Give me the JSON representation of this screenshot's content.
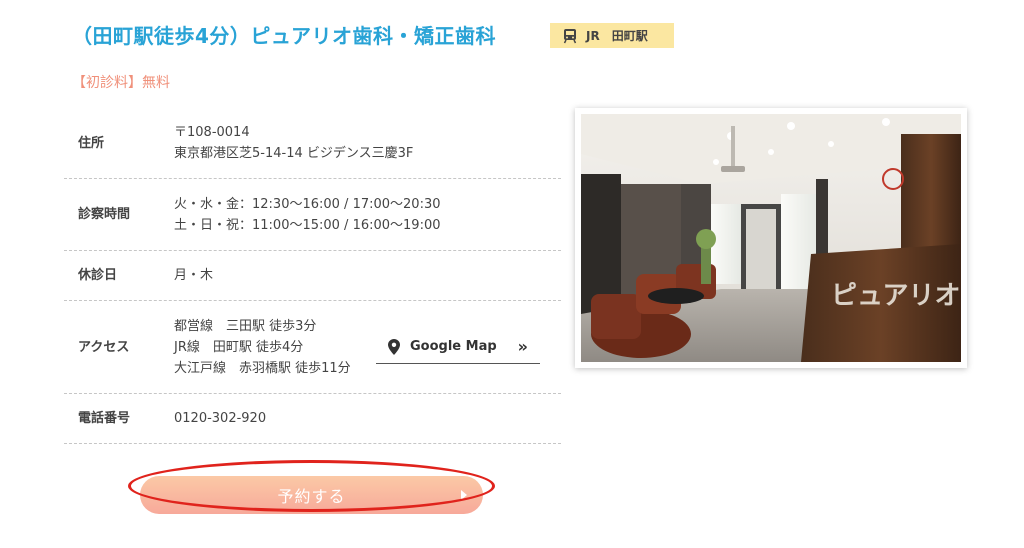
{
  "header": {
    "title": "（田町駅徒歩4分）ピュアリオ歯科・矯正歯科",
    "station_line": "JR",
    "station_name": "田町駅"
  },
  "fee": {
    "label": "【初診料】",
    "value": "無料"
  },
  "info": {
    "address": {
      "label": "住所",
      "postal": "〒108-0014",
      "street": "東京都港区芝5-14-14 ビジデンス三慶3F"
    },
    "hours": {
      "label": "診察時間",
      "line1": "火・水・金：12:30〜16:00 / 17:00〜20:30",
      "line2": "土・日・祝：11:00〜15:00 / 16:00〜19:00"
    },
    "closed": {
      "label": "休診日",
      "value": "月・木"
    },
    "access": {
      "label": "アクセス",
      "line1": "都営線　三田駅 徒歩3分",
      "line2": "JR線　田町駅 徒歩4分",
      "line3": "大江戸線　赤羽橋駅 徒歩11分",
      "map_link": "Google Map",
      "map_arrow": "»"
    },
    "phone": {
      "label": "電話番号",
      "value": "0120-302-920"
    }
  },
  "reserve": {
    "label": "予約する"
  },
  "photo": {
    "sign_text": "ピュアリオ"
  },
  "colors": {
    "title": "#29a3d6",
    "badge_bg": "#fbe7a1",
    "fee": "#f0907a",
    "button_gradient_top": "#fbc9a6",
    "button_gradient_bottom": "#f7a99a",
    "annotation": "#e0231c"
  }
}
